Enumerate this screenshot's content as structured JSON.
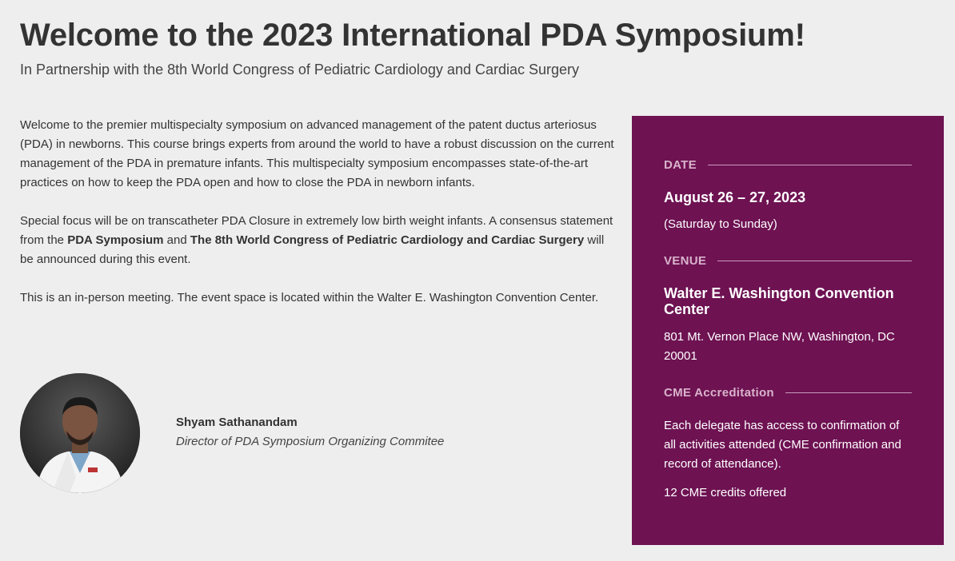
{
  "header": {
    "title": "Welcome to the 2023 International PDA Symposium!",
    "subtitle": "In Partnership with the 8th World Congress of Pediatric Cardiology and Cardiac Surgery"
  },
  "intro": {
    "p1": "Welcome to the premier multispecialty symposium on advanced management of the patent ductus arteriosus (PDA) in newborns. This course brings experts from around the world to have a robust discussion on the current management of the PDA in premature infants. This multispecialty symposium encompasses state-of-the-art practices on how to keep the PDA open and how to close the PDA in newborn infants.",
    "p2_a": "Special focus will be on transcatheter PDA Closure in extremely low birth weight infants. A consensus statement from the ",
    "p2_b": "PDA Symposium",
    "p2_c": " and ",
    "p2_d": "The 8th World Congress of Pediatric Cardiology and Cardiac Surgery",
    "p2_e": " will be announced during this event.",
    "p3": "This is an in-person meeting. The event space is located within the Walter E. Washington Convention Center."
  },
  "organizer": {
    "avatar_icon": "person-photo-icon",
    "name": "Shyam Sathanandam",
    "role": "Director of PDA Symposium Organizing Commitee"
  },
  "info": {
    "background": "#6e1252",
    "date": {
      "label": "DATE",
      "value": "August 26 – 27, 2023",
      "detail": "(Saturday to Sunday)"
    },
    "venue": {
      "label": "VENUE",
      "name": "Walter E. Washington Convention Center",
      "address": "801 Mt. Vernon Place NW, Washington, DC 20001"
    },
    "cme": {
      "label": "CME Accreditation",
      "text": "Each delegate has access to confirmation of all activities attended (CME confirmation and record of attendance).",
      "credits": "12 CME credits offered"
    }
  }
}
